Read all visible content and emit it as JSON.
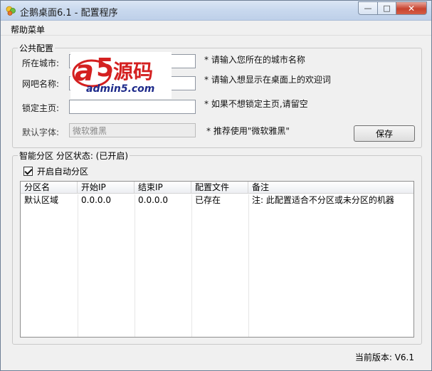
{
  "window": {
    "title": "企鹅桌面6.1 - 配置程序",
    "app_icon": "qq-desktop-icon"
  },
  "menu": {
    "help": "帮助菜单"
  },
  "public_config": {
    "legend": "公共配置",
    "city_label": "所在城市:",
    "city_value": "",
    "city_hint": "* 请输入您所在的城市名称",
    "cafe_label": "网吧名称:",
    "cafe_value": "",
    "cafe_hint": "* 请输入想显示在桌面上的欢迎词",
    "home_label": "锁定主页:",
    "home_value": "",
    "home_hint": "* 如果不想锁定主页,请留空",
    "font_label": "默认字体:",
    "font_value": "微软雅黑",
    "font_hint": "* 推荐使用\"微软雅黑\"",
    "save_label": "保存"
  },
  "partition": {
    "legend": "智能分区 分区状态: (已开启)",
    "auto_label": "开启自动分区",
    "auto_checked": true,
    "columns": [
      "分区名",
      "开始IP",
      "结束IP",
      "配置文件",
      "备注"
    ],
    "rows": [
      [
        "默认区域",
        "0.0.0.0",
        "0.0.0.0",
        "已存在",
        "注: 此配置适合不分区或未分区的机器"
      ]
    ]
  },
  "watermark": {
    "brand_a": "a",
    "brand_5": "5",
    "brand_cn": "源码",
    "site": "admin5.com"
  },
  "footer": {
    "version": "当前版本: V6.1"
  }
}
